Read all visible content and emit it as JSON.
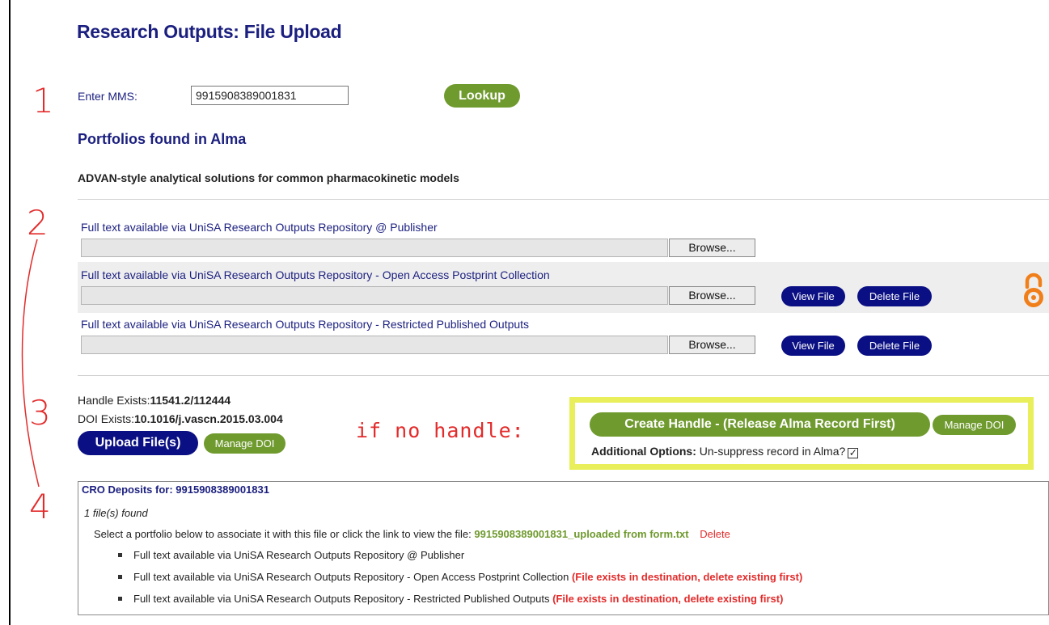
{
  "page_title": "Research Outputs: File Upload",
  "markers": [
    "1",
    "2",
    "3",
    "4"
  ],
  "lookup": {
    "label": "Enter MMS:",
    "mms_value": "9915908389001831",
    "button": "Lookup"
  },
  "portfolios_section": {
    "title": "Portfolios found in Alma",
    "record_title": "ADVAN-style analytical solutions for common pharmacokinetic models",
    "items": [
      {
        "label": "Full text available via UniSA Research Outputs Repository @ Publisher",
        "browse": "Browse...",
        "view": "",
        "delete": ""
      },
      {
        "label": "Full text available via UniSA Research Outputs Repository - Open Access Postprint Collection",
        "browse": "Browse...",
        "view": "View File",
        "delete": "Delete File"
      },
      {
        "label": "Full text available via UniSA Research Outputs Repository - Restricted Published Outputs",
        "browse": "Browse...",
        "view": "View File",
        "delete": "Delete File"
      }
    ],
    "open_access_icon": "open-access-icon",
    "accent_color": "#f07f1a"
  },
  "handle": {
    "handle_label": "Handle Exists:",
    "handle_value": "11541.2/112444",
    "doi_label": "DOI Exists:",
    "doi_value": "10.1016/j.vascn.2015.03.004",
    "upload_button": "Upload File(s)",
    "manage_doi": "Manage DOI"
  },
  "annotation_text": "if no handle:",
  "no_handle_box": {
    "create_button": "Create Handle - (Release Alma Record First)",
    "manage_doi": "Manage DOI",
    "options_label": "Additional Options:",
    "options_text": "Un-suppress record in Alma?",
    "checkbox_checked": true
  },
  "cro": {
    "title": "CRO Deposits for: 9915908389001831",
    "files_found": "1 file(s) found",
    "select_text": "Select a portfolio below to associate it with this file or click the link to view the file:",
    "file_link": "9915908389001831_uploaded from form.txt",
    "delete_link": "Delete",
    "portfolios": [
      {
        "label": "Full text available via UniSA Research Outputs Repository @ Publisher",
        "warning": ""
      },
      {
        "label": "Full text available via UniSA Research Outputs Repository - Open Access Postprint Collection",
        "warning": "(File exists in destination, delete existing first)"
      },
      {
        "label": "Full text available via UniSA Research Outputs Repository - Restricted Published Outputs",
        "warning": "(File exists in destination, delete existing first)"
      }
    ]
  },
  "colors": {
    "navy": "#1b1f7f",
    "button_blue": "#0a0f83",
    "button_green": "#6f9a2e",
    "annotation_red": "#e32b2b",
    "highlight_yellow": "#e8ef5a"
  }
}
